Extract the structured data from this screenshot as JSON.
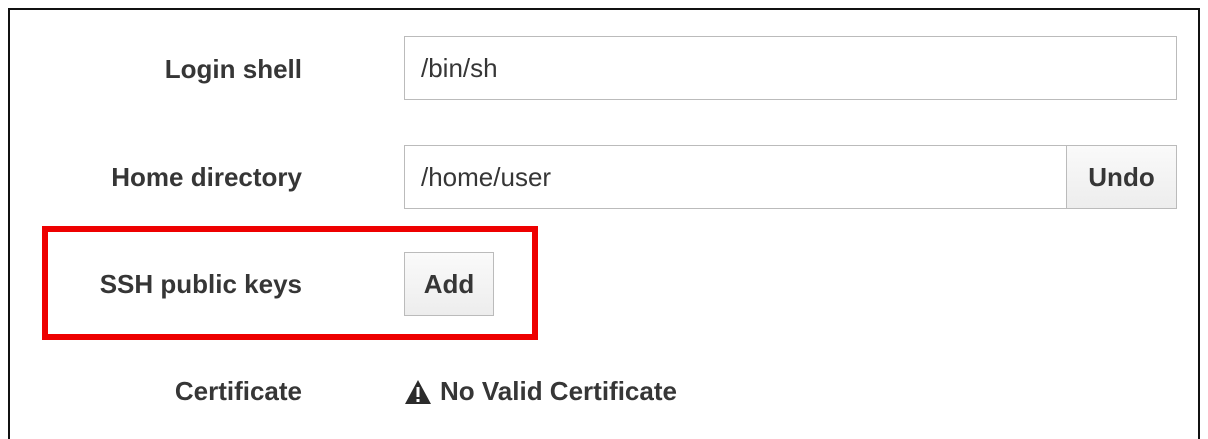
{
  "fields": {
    "login_shell": {
      "label": "Login shell",
      "value": "/bin/sh"
    },
    "home_directory": {
      "label": "Home directory",
      "value": "/home/user",
      "undo_label": "Undo"
    },
    "ssh_public_keys": {
      "label": "SSH public keys",
      "add_label": "Add"
    },
    "certificate": {
      "label": "Certificate",
      "status": "No Valid Certificate",
      "status_icon": "warning-triangle-icon"
    }
  },
  "colors": {
    "highlight": "#ee0000",
    "text": "#363636",
    "border": "#bbbbbb"
  }
}
